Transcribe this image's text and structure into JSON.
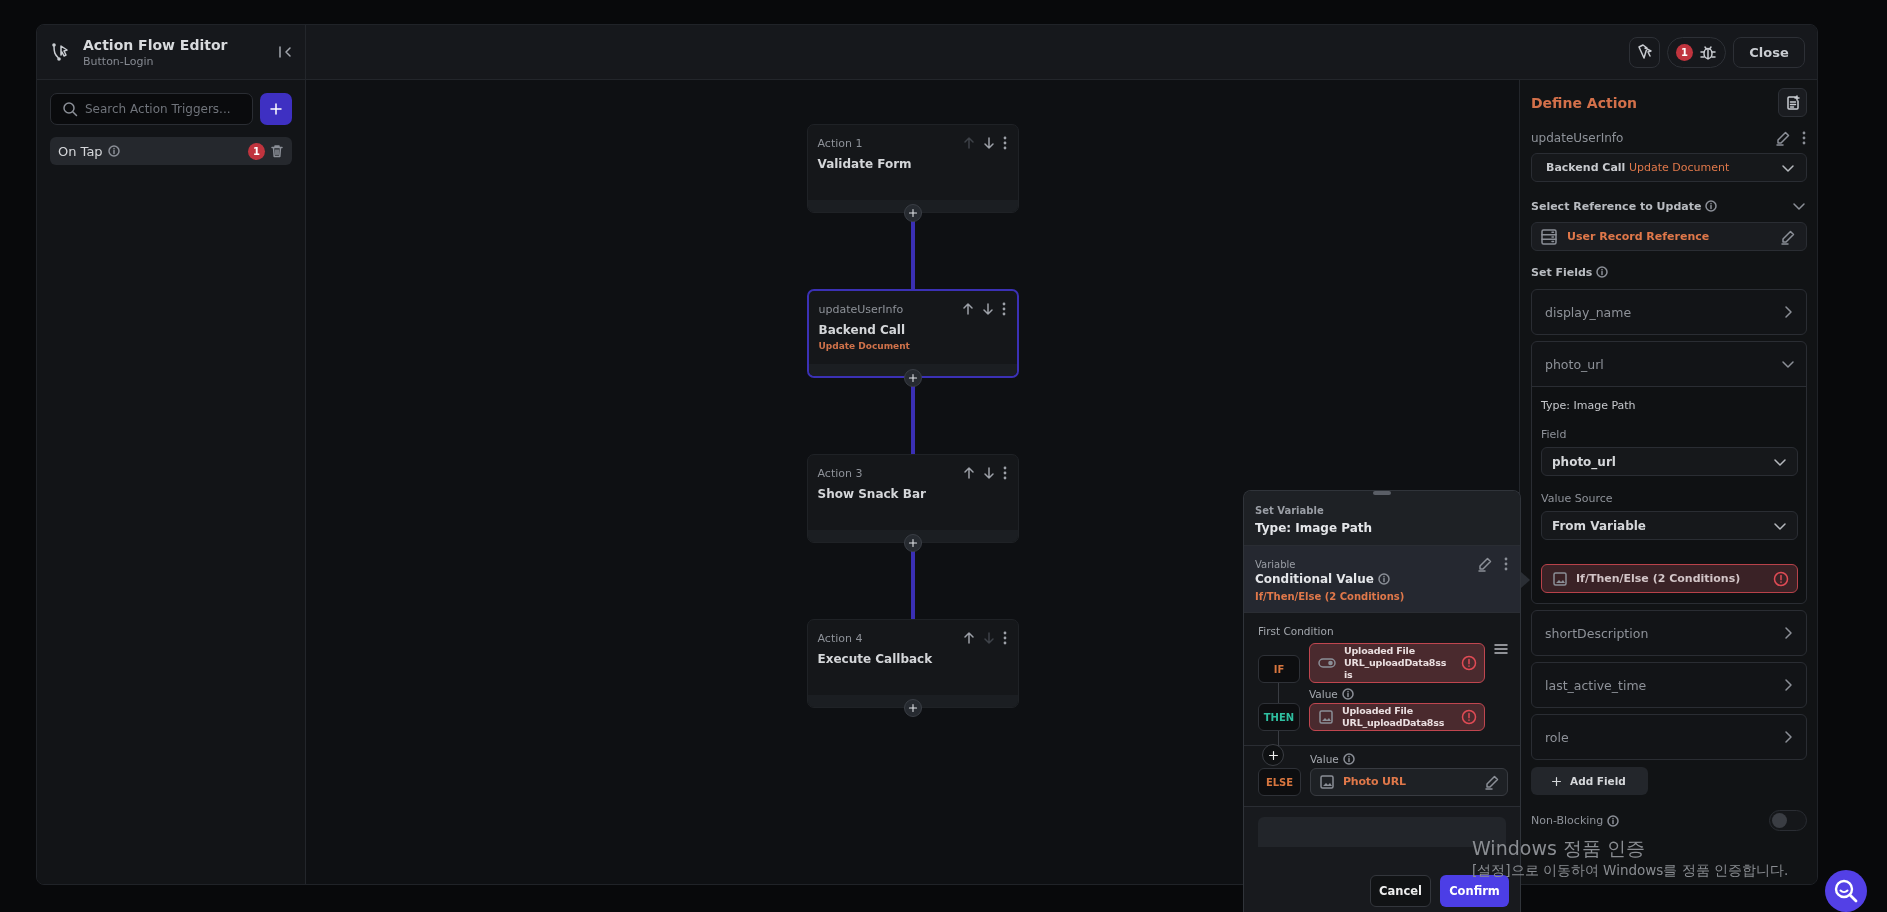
{
  "header": {
    "title": "Action Flow Editor",
    "subtitle": "Button-Login",
    "debug_count": "1",
    "close": "Close"
  },
  "sidebar": {
    "search": {
      "placeholder": "Search Action Triggers..."
    },
    "triggers": [
      {
        "label": "On Tap",
        "badge": "1",
        "selected": true
      }
    ]
  },
  "flow": {
    "nodes": [
      {
        "caption": "Action 1",
        "title": "Validate Form",
        "selected": false,
        "can_move_up": false,
        "can_move_down": true
      },
      {
        "caption": "updateUserInfo",
        "title": "Backend Call",
        "subtitle": "Update Document",
        "selected": true,
        "can_move_up": true,
        "can_move_down": true
      },
      {
        "caption": "Action 3",
        "title": "Show Snack Bar",
        "selected": false,
        "can_move_up": true,
        "can_move_down": true
      },
      {
        "caption": "Action 4",
        "title": "Execute Callback",
        "selected": false,
        "can_move_up": true,
        "can_move_down": false
      }
    ]
  },
  "define_action": {
    "title": "Define Action",
    "action_name": "updateUserInfo",
    "type": {
      "category": "Backend Call",
      "operation": "Update Document"
    },
    "reference_label": "Select Reference to Update",
    "reference": "User Record Reference",
    "fields_label": "Set Fields",
    "fields": [
      {
        "name": "display_name",
        "expanded": false
      },
      {
        "name": "photo_url",
        "expanded": true,
        "detail": {
          "type": "Type: Image Path",
          "field_label": "Field",
          "field_value": "photo_url",
          "source_label": "Value Source",
          "source_value": "From Variable",
          "value": "If/Then/Else (2 Conditions)",
          "error": true
        }
      },
      {
        "name": "shortDescription",
        "expanded": false
      },
      {
        "name": "last_active_time",
        "expanded": false
      },
      {
        "name": "role",
        "expanded": false
      }
    ],
    "add_field": "Add Field",
    "non_blocking": {
      "label": "Non-Blocking",
      "on": false
    }
  },
  "variable_popup": {
    "header_caption": "Set Variable",
    "header_title": "Type: Image Path",
    "variable_caption": "Variable",
    "variable_title": "Conditional Value",
    "variable_summary": "If/Then/Else (2 Conditions)",
    "condition_label": "First Condition",
    "branches": [
      {
        "kind": "if",
        "chip": "IF",
        "value": "Uploaded File URL_uploadData8ss is",
        "error": true
      },
      {
        "kind": "then",
        "chip": "THEN",
        "label": "Value",
        "value": "Uploaded File URL_uploadData8ss",
        "error": true
      },
      {
        "kind": "else",
        "chip": "ELSE",
        "label": "Value",
        "value": "Photo URL",
        "error": false
      }
    ],
    "cancel": "Cancel",
    "confirm": "Confirm"
  },
  "os_notice": {
    "title": "Windows 정품 인증",
    "message": "[설정]으로 이동하여 Windows를 정품 인증합니다."
  }
}
